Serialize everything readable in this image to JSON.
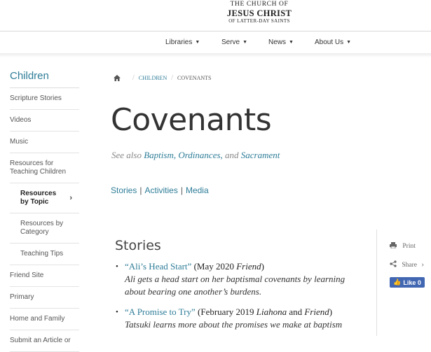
{
  "header": {
    "logo_line1": "THE CHURCH OF",
    "logo_line2": "JESUS CHRIST",
    "logo_line3": "OF LATTER-DAY SAINTS"
  },
  "nav": {
    "libraries": "Libraries",
    "serve": "Serve",
    "news": "News",
    "about": "About Us"
  },
  "sidebar": {
    "title": "Children",
    "items": [
      "Scripture Stories",
      "Videos",
      "Music",
      "Resources for Teaching Children",
      "Resources by Topic",
      "Resources by Category",
      "Teaching Tips",
      "Friend Site",
      "Primary",
      "Home and Family",
      "Submit an Article or"
    ]
  },
  "breadcrumb": {
    "children": "CHILDREN",
    "current": "COVENANTS"
  },
  "page": {
    "title": "Covenants",
    "see_also_prefix": "See also",
    "see_also_1": "Baptism,",
    "see_also_2": "Ordinances,",
    "see_also_and": "and",
    "see_also_3": "Sacrament"
  },
  "jump_links": {
    "stories": "Stories",
    "activities": "Activities",
    "media": "Media",
    "separator": "|"
  },
  "tools": {
    "print": "Print",
    "share": "Share",
    "like": "Like 0"
  },
  "stories": {
    "heading": "Stories",
    "items": [
      {
        "title": "“Ali’s Head Start”",
        "date_pre": "(May 2020",
        "magazine": "Friend",
        "date_post": ")",
        "desc": "Ali gets a head start on her baptismal covenants by learning about bearing one another’s burdens."
      },
      {
        "title": "“A Promise to Try”",
        "date_pre": "(February 2019",
        "magazine": "Liahona",
        "mid": "and",
        "magazine2": "Friend",
        "date_post": ")",
        "desc": "Tatsuki learns more about the promises we make at baptism"
      }
    ]
  }
}
